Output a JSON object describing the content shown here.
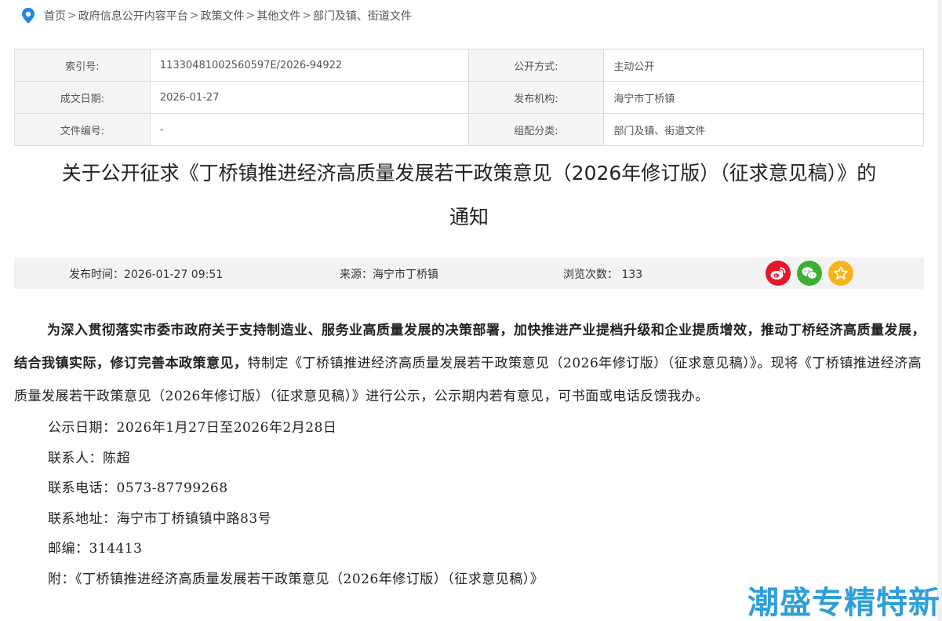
{
  "breadcrumb": {
    "items": [
      "首页",
      "政府信息公开内容平台",
      "政策文件",
      "其他文件",
      "部门及镇、街道文件"
    ],
    "separator": ">"
  },
  "meta": {
    "index_label": "索引号:",
    "index_value": "11330481002560597E/2026-94922",
    "open_label": "公开方式:",
    "open_value": "主动公开",
    "date_label": "成文日期:",
    "date_value": "2026-01-27",
    "publisher_label": "发布机构:",
    "publisher_value": "海宁市丁桥镇",
    "docno_label": "文件编号:",
    "docno_value": "-",
    "category_label": "组配分类:",
    "category_value": "部门及镇、街道文件"
  },
  "title": {
    "line1": "关于公开征求《丁桥镇推进经济高质量发展若干政策意见（2026年修订版）（征求意见稿）》的",
    "line2": "通知"
  },
  "infobar": {
    "publish_time": "发布时间：2026-01-27 09:51",
    "source": "来源：海宁市丁桥镇",
    "views": "浏览次数： 133"
  },
  "article": {
    "p1_bold": "为深入贯彻落实市委市政府关于支持制造业、服务业高质量发展的决策部署，加快推进产业提档升级和企业提质增效，推动丁桥经济高质量发展，结合我镇实际，修订完善本政策意见，",
    "p1_rest": "特制定《丁桥镇推进经济高质量发展若干政策意见（2026年修订版）（征求意见稿）》。现将《丁桥镇推进经济高质量发展若干政策意见（2026年修订版）（征求意见稿）》进行公示，公示期内若有意见，可书面或电话反馈我办。",
    "period": "公示日期：2026年1月27日至2026年2月28日",
    "contact": "联系人：陈超",
    "phone": "联系电话：0573-87799268",
    "address": "联系地址：海宁市丁桥镇镇中路83号",
    "postcode": "邮编：314413",
    "attachment": "附：《丁桥镇推进经济高质量发展若干政策意见（2026年修订版）（征求意见稿）》"
  },
  "watermark": "潮盛专精特新",
  "icons": [
    "location-pin-icon",
    "weibo-icon",
    "wechat-icon",
    "star-icon"
  ],
  "colors": {
    "pin": "#1e88e5",
    "weibo": "#e6162d",
    "wechat": "#3cb034",
    "favorite": "#f6b51e",
    "watermark": "#2f9fd9"
  }
}
